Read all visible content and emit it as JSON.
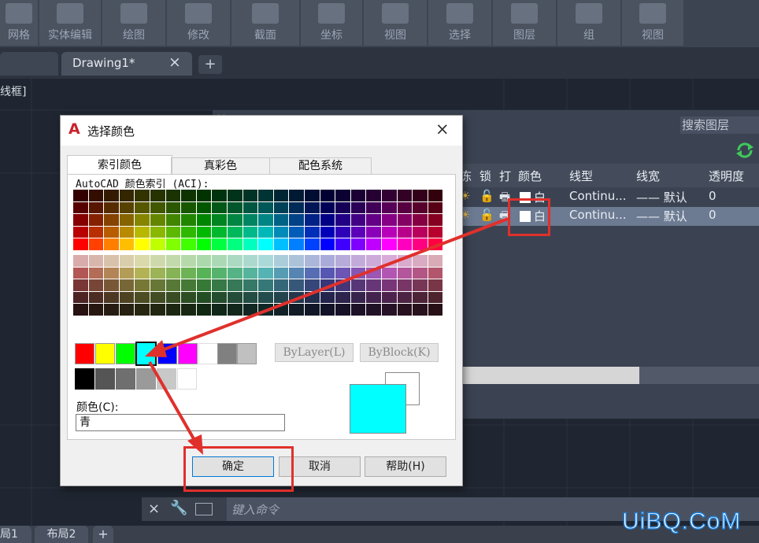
{
  "ribbon": {
    "groups": [
      "网格",
      "实体编辑",
      "绘图",
      "修改",
      "截面",
      "坐标",
      "视图",
      "选择",
      "图层",
      "组",
      "视图"
    ]
  },
  "tabs": {
    "active": "Drawing1*",
    "close": "×",
    "add": "+"
  },
  "canvas": {
    "viewport_label": "线框]"
  },
  "layer_panel": {
    "search_placeholder": "搜索图层",
    "headers": [
      "冻",
      "锁",
      "打",
      "颜色",
      "线型",
      "线宽",
      "透明度"
    ],
    "rows": [
      {
        "color_name": "白",
        "linetype": "Continu...",
        "lineweight": "—— 默认",
        "transparency": "0"
      },
      {
        "color_name": "白",
        "linetype": "Continu...",
        "lineweight": "—— 默认",
        "transparency": "0"
      }
    ]
  },
  "dialog": {
    "title": "选择颜色",
    "logo": "A",
    "close": "×",
    "tabs": [
      "索引颜色",
      "真彩色",
      "配色系统"
    ],
    "aci_label": "AutoCAD 颜色索引 (ACI):",
    "bylayer": "ByLayer(L)",
    "byblock": "ByBlock(K)",
    "color_label": "颜色(C):",
    "color_value": "青",
    "ok": "确定",
    "cancel": "取消",
    "help": "帮助(H)",
    "selected_color": "#00ffff"
  },
  "command": {
    "placeholder": "键入命令",
    "close": "×"
  },
  "layout_tabs": [
    "局1",
    "布局2",
    "+"
  ],
  "watermark": "UiBQ.CoM",
  "colors": {
    "standard": [
      "#ff0000",
      "#ffff00",
      "#00ff00",
      "#00ffff",
      "#0000ff",
      "#ff00ff",
      "#ffffff",
      "#808080",
      "#c0c0c0"
    ],
    "grays": [
      "#000000",
      "#555555",
      "#6f6f6f",
      "#9a9a9a",
      "#c8c8c8",
      "#ffffff"
    ],
    "accent_red": "#e0302c"
  }
}
